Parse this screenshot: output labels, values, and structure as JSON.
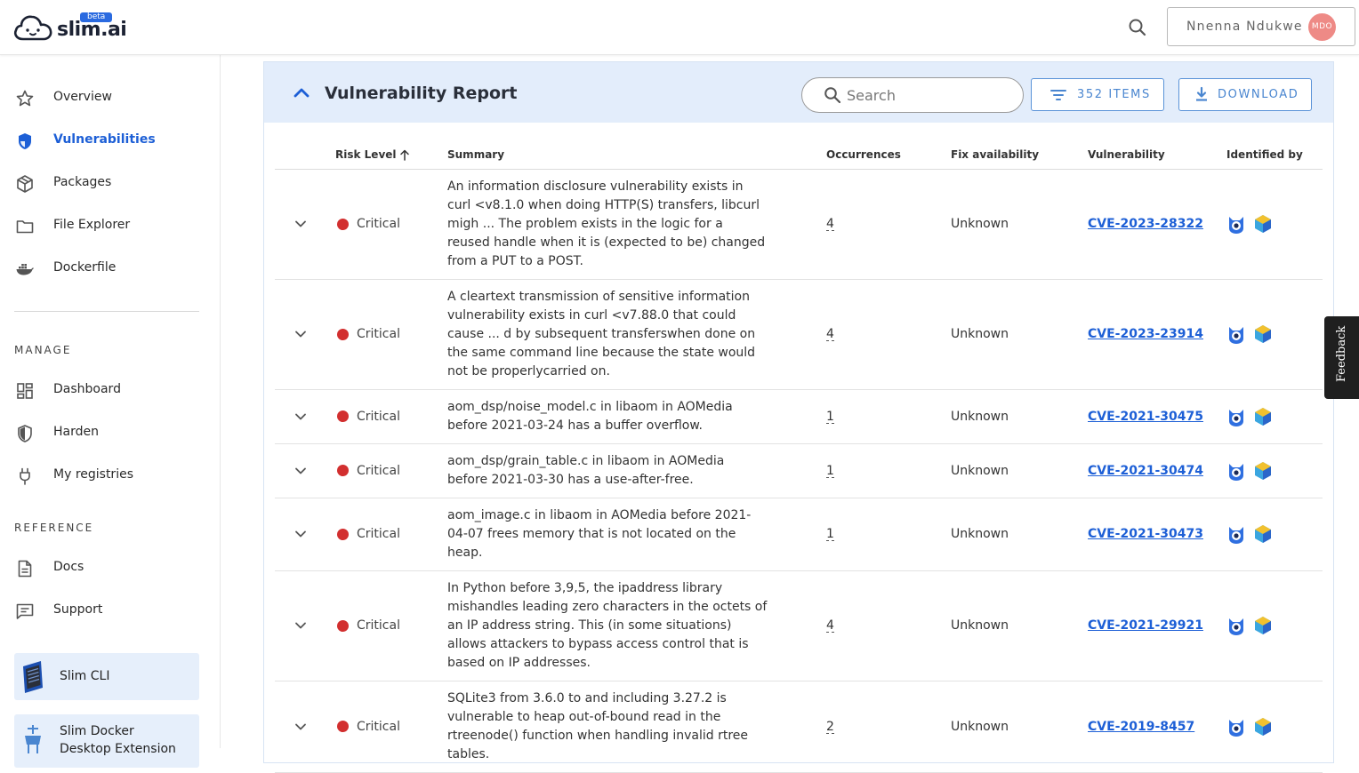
{
  "app": {
    "brand": "slim.ai",
    "badge": "beta"
  },
  "topbar": {
    "user_name": "Nnenna Ndukwe",
    "avatar_initials": "MDO",
    "avatar_color": "#ee8a86"
  },
  "sidebar": {
    "items": [
      {
        "label": "Overview",
        "icon": "star-icon"
      },
      {
        "label": "Vulnerabilities",
        "icon": "shield-icon",
        "active": true
      },
      {
        "label": "Packages",
        "icon": "package-icon"
      },
      {
        "label": "File Explorer",
        "icon": "folder-icon"
      },
      {
        "label": "Dockerfile",
        "icon": "docker-icon"
      }
    ],
    "manage_title": "MANAGE",
    "manage": [
      {
        "label": "Dashboard",
        "icon": "dashboard-icon"
      },
      {
        "label": "Harden",
        "icon": "harden-shield-icon"
      },
      {
        "label": "My registries",
        "icon": "plug-icon"
      }
    ],
    "reference_title": "REFERENCE",
    "reference": [
      {
        "label": "Docs",
        "icon": "document-icon"
      },
      {
        "label": "Support",
        "icon": "chat-icon"
      }
    ],
    "promos": [
      {
        "label": "Slim CLI"
      },
      {
        "label": "Slim Docker",
        "label2": "Desktop Extension"
      }
    ]
  },
  "report": {
    "title": "Vulnerability Report",
    "search_placeholder": "Search",
    "items_label": "352 ITEMS",
    "download_label": "DOWNLOAD",
    "columns": {
      "risk": "Risk Level",
      "summary": "Summary",
      "occurrences": "Occurrences",
      "fix": "Fix availability",
      "vulnerability": "Vulnerability",
      "identified": "Identified by"
    },
    "rows": [
      {
        "risk": "Critical",
        "summary": "An information disclosure vulnerability exists in curl <v8.1.0 when doing HTTP(S) transfers, libcurl migh ... The problem exists in the logic for a reused handle when it is (expected to be) changed from a PUT to a POST.",
        "occurrences": "4",
        "fix": "Unknown",
        "cve": "CVE-2023-28322"
      },
      {
        "risk": "Critical",
        "summary": "A cleartext transmission of sensitive information vulnerability exists in curl <v7.88.0 that could cause ... d by subsequent transferswhen done on the same command line because the state would not be properlycarried on.",
        "occurrences": "4",
        "fix": "Unknown",
        "cve": "CVE-2023-23914"
      },
      {
        "risk": "Critical",
        "summary": "aom_dsp/noise_model.c in libaom in AOMedia before 2021-03-24 has a buffer overflow.",
        "occurrences": "1",
        "fix": "Unknown",
        "cve": "CVE-2021-30475"
      },
      {
        "risk": "Critical",
        "summary": "aom_dsp/grain_table.c in libaom in AOMedia before 2021-03-30 has a use-after-free.",
        "occurrences": "1",
        "fix": "Unknown",
        "cve": "CVE-2021-30474"
      },
      {
        "risk": "Critical",
        "summary": "aom_image.c in libaom in AOMedia before 2021-04-07 frees memory that is not located on the heap.",
        "occurrences": "1",
        "fix": "Unknown",
        "cve": "CVE-2021-30473"
      },
      {
        "risk": "Critical",
        "summary": "In Python before 3,9,5, the ipaddress library mishandles leading zero characters in the octets of an IP address string. This (in some situations) allows attackers to bypass access control that is based on IP addresses.",
        "occurrences": "4",
        "fix": "Unknown",
        "cve": "CVE-2021-29921"
      },
      {
        "risk": "Critical",
        "summary": "SQLite3 from 3.6.0 to and including 3.27.2 is vulnerable to heap out-of-bound read in the rtreenode() function when handling invalid rtree tables.",
        "occurrences": "2",
        "fix": "Unknown",
        "cve": "CVE-2019-8457"
      }
    ]
  },
  "feedback_label": "Feedback",
  "colors": {
    "accent": "#1d5fd6",
    "critical": "#d22f2f",
    "header_bg": "#e3edfb"
  }
}
